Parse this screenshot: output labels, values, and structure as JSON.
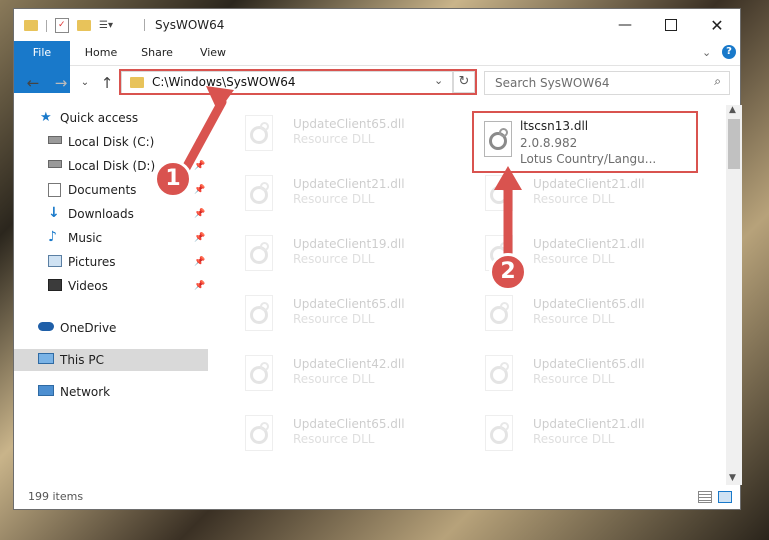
{
  "window": {
    "title": "SysWOW64"
  },
  "ribbon": {
    "tabs": [
      "File",
      "Home",
      "Share",
      "View"
    ]
  },
  "address": {
    "path": "C:\\Windows\\SysWOW64"
  },
  "search": {
    "placeholder": "Search SysWOW64"
  },
  "sidebar": {
    "items": [
      {
        "label": "Quick access",
        "icon": "star-icon",
        "pinned": false
      },
      {
        "label": "Local Disk (C:)",
        "icon": "drive-icon",
        "pinned": true
      },
      {
        "label": "Local Disk (D:)",
        "icon": "drive-icon",
        "pinned": true
      },
      {
        "label": "Documents",
        "icon": "documents-icon",
        "pinned": true
      },
      {
        "label": "Downloads",
        "icon": "download-icon",
        "pinned": true
      },
      {
        "label": "Music",
        "icon": "music-icon",
        "pinned": true
      },
      {
        "label": "Pictures",
        "icon": "pictures-icon",
        "pinned": true
      },
      {
        "label": "Videos",
        "icon": "videos-icon",
        "pinned": true
      },
      {
        "label": "OneDrive",
        "icon": "cloud-icon",
        "pinned": false
      },
      {
        "label": "This PC",
        "icon": "computer-icon",
        "pinned": false,
        "selected": true
      },
      {
        "label": "Network",
        "icon": "network-icon",
        "pinned": false
      }
    ]
  },
  "files": [
    {
      "name": "UpdateClient65.dll",
      "type": "Resource DLL"
    },
    {
      "name": "ltscsn13.dll",
      "type": "2.0.8.982",
      "desc": "Lotus Country/Langu...",
      "highlighted": true
    },
    {
      "name": "UpdateClient21.dll",
      "type": "Resource DLL"
    },
    {
      "name": "UpdateClient21.dll",
      "type": "Resource DLL"
    },
    {
      "name": "UpdateClient19.dll",
      "type": "Resource DLL"
    },
    {
      "name": "UpdateClient21.dll",
      "type": "Resource DLL"
    },
    {
      "name": "UpdateClient65.dll",
      "type": "Resource DLL"
    },
    {
      "name": "UpdateClient65.dll",
      "type": "Resource DLL"
    },
    {
      "name": "UpdateClient42.dll",
      "type": "Resource DLL"
    },
    {
      "name": "UpdateClient65.dll",
      "type": "Resource DLL"
    },
    {
      "name": "UpdateClient65.dll",
      "type": "Resource DLL"
    },
    {
      "name": "UpdateClient21.dll",
      "type": "Resource DLL"
    }
  ],
  "status": {
    "count": "199 items"
  },
  "annotations": {
    "step1": "1",
    "step2": "2",
    "color": "#d9534f"
  },
  "colors": {
    "accent": "#1979ca",
    "selection": "#d9d9d9"
  }
}
